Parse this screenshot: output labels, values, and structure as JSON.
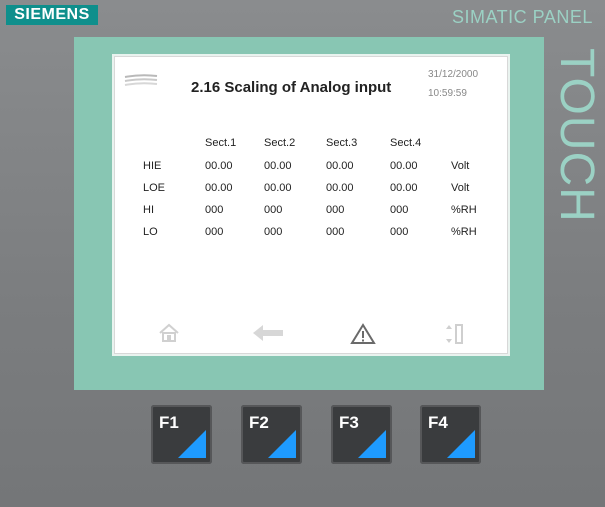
{
  "panel": {
    "brand": "SIEMENS",
    "series": "SIMATIC PANEL",
    "touch": "TOUCH"
  },
  "screen": {
    "title": "2.16 Scaling of Analog input",
    "date": "31/12/2000",
    "time": "10:59:59",
    "columns": [
      "Sect.1",
      "Sect.2",
      "Sect.3",
      "Sect.4"
    ],
    "rows": [
      {
        "label": "HIE",
        "values": [
          "00.00",
          "00.00",
          "00.00",
          "00.00"
        ],
        "unit": "Volt"
      },
      {
        "label": "LOE",
        "values": [
          "00.00",
          "00.00",
          "00.00",
          "00.00"
        ],
        "unit": "Volt"
      },
      {
        "label": "HI",
        "values": [
          "000",
          "000",
          "000",
          "000"
        ],
        "unit": "%RH"
      },
      {
        "label": "LO",
        "values": [
          "000",
          "000",
          "000",
          "000"
        ],
        "unit": "%RH"
      }
    ],
    "nav_icons": [
      "home-icon",
      "back-arrow-icon",
      "warning-icon",
      "scroll-icon"
    ]
  },
  "function_keys": [
    {
      "label": "F1"
    },
    {
      "label": "F2"
    },
    {
      "label": "F3"
    },
    {
      "label": "F4"
    }
  ],
  "colors": {
    "brand": "#0f8f8c",
    "bezel": "#88c6b3",
    "key_accent": "#1e9bff"
  }
}
